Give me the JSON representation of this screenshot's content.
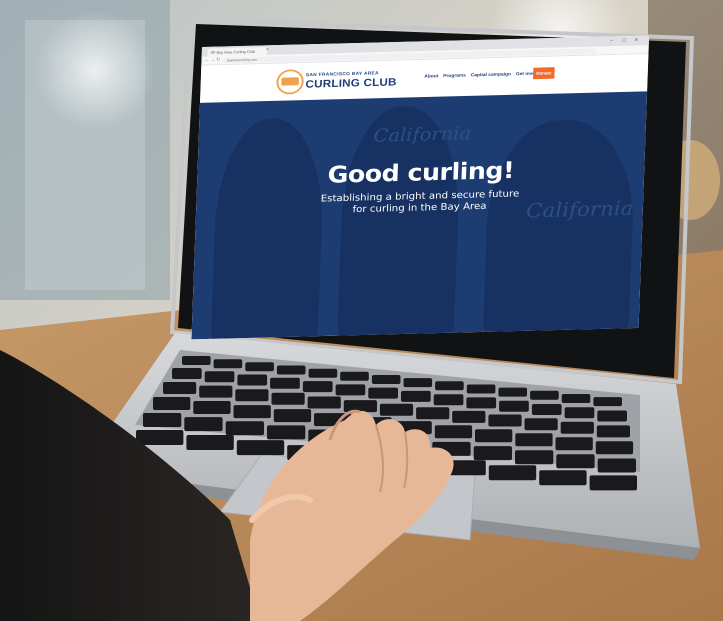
{
  "browser": {
    "tab_title": "SF Bay Area Curling Club",
    "tab_close": "×",
    "address": "bayareacurling.com",
    "win_min": "–",
    "win_max": "▢",
    "win_close": "✕",
    "back": "←",
    "forward": "→",
    "reload": "↻"
  },
  "site": {
    "logo_subtitle": "SAN FRANCISCO BAY AREA",
    "logo_title": "CURLING CLUB",
    "nav": [
      "About",
      "Programs",
      "Capital campaign",
      "Get involved"
    ],
    "donate_label": "Donate"
  },
  "hero": {
    "title": "Good curling!",
    "subtitle_line1": "Establishing a bright and secure future",
    "subtitle_line2": "for curling in the Bay Area",
    "jacket_text_1": "California",
    "jacket_text_2": "California",
    "colors": {
      "hero_bg": "#1d3c72",
      "accent": "#f26a2e",
      "logo_ring": "#f0a24a"
    }
  },
  "icons": [
    "laptop-icon",
    "hand-icon"
  ]
}
